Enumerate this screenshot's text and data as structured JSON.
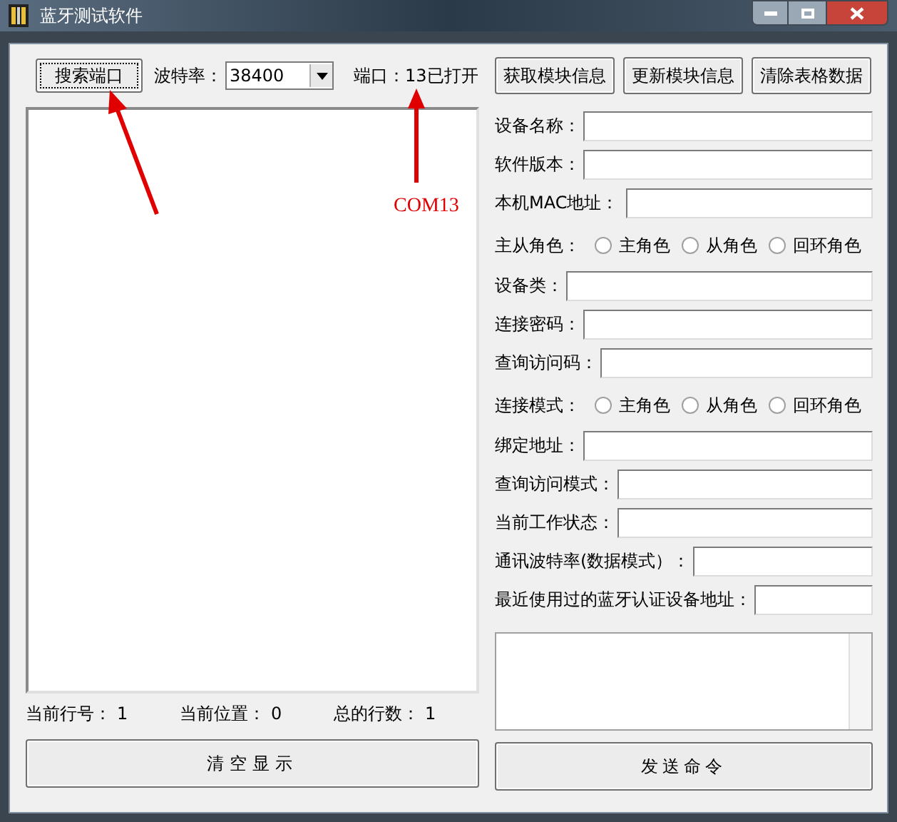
{
  "window": {
    "title": "蓝牙测试软件"
  },
  "toolbar": {
    "search_button": "搜索端口",
    "baud_label": "波特率：",
    "baud_value": "38400",
    "port_status": "端口：13已打开",
    "buttons": [
      "获取模块信息",
      "更新模块信息",
      "清除表格数据"
    ]
  },
  "status": [
    {
      "label": "当前行号：",
      "value": "1"
    },
    {
      "label": "当前位置：",
      "value": "0"
    },
    {
      "label": "总的行数：",
      "value": "1"
    }
  ],
  "clear_button": "清空显示",
  "form": [
    {
      "kind": "field",
      "label": "设备名称："
    },
    {
      "kind": "field",
      "label": "软件版本："
    },
    {
      "kind": "field",
      "label": "本机MAC地址："
    },
    {
      "kind": "radio",
      "label": "主从角色：",
      "options": [
        {
          "label": "主角色",
          "selected": false
        },
        {
          "label": "从角色",
          "selected": false
        },
        {
          "label": "回环角色",
          "selected": false
        }
      ]
    },
    {
      "kind": "field",
      "label": "设备类："
    },
    {
      "kind": "field",
      "label": "连接密码："
    },
    {
      "kind": "field",
      "label": "查询访问码："
    },
    {
      "kind": "radio",
      "label": "连接模式：",
      "options": [
        {
          "label": "主角色",
          "selected": false
        },
        {
          "label": "从角色",
          "selected": false
        },
        {
          "label": "回环角色",
          "selected": false
        }
      ]
    },
    {
      "kind": "field",
      "label": "绑定地址："
    },
    {
      "kind": "field",
      "label": "查询访问模式："
    },
    {
      "kind": "field",
      "label": "当前工作状态："
    },
    {
      "kind": "field",
      "label": "通讯波特率(数据模式）："
    },
    {
      "kind": "field",
      "label": "最近使用过的蓝牙认证设备地址："
    }
  ],
  "send_button": "发送命令",
  "annotation": {
    "text": "COM13"
  }
}
